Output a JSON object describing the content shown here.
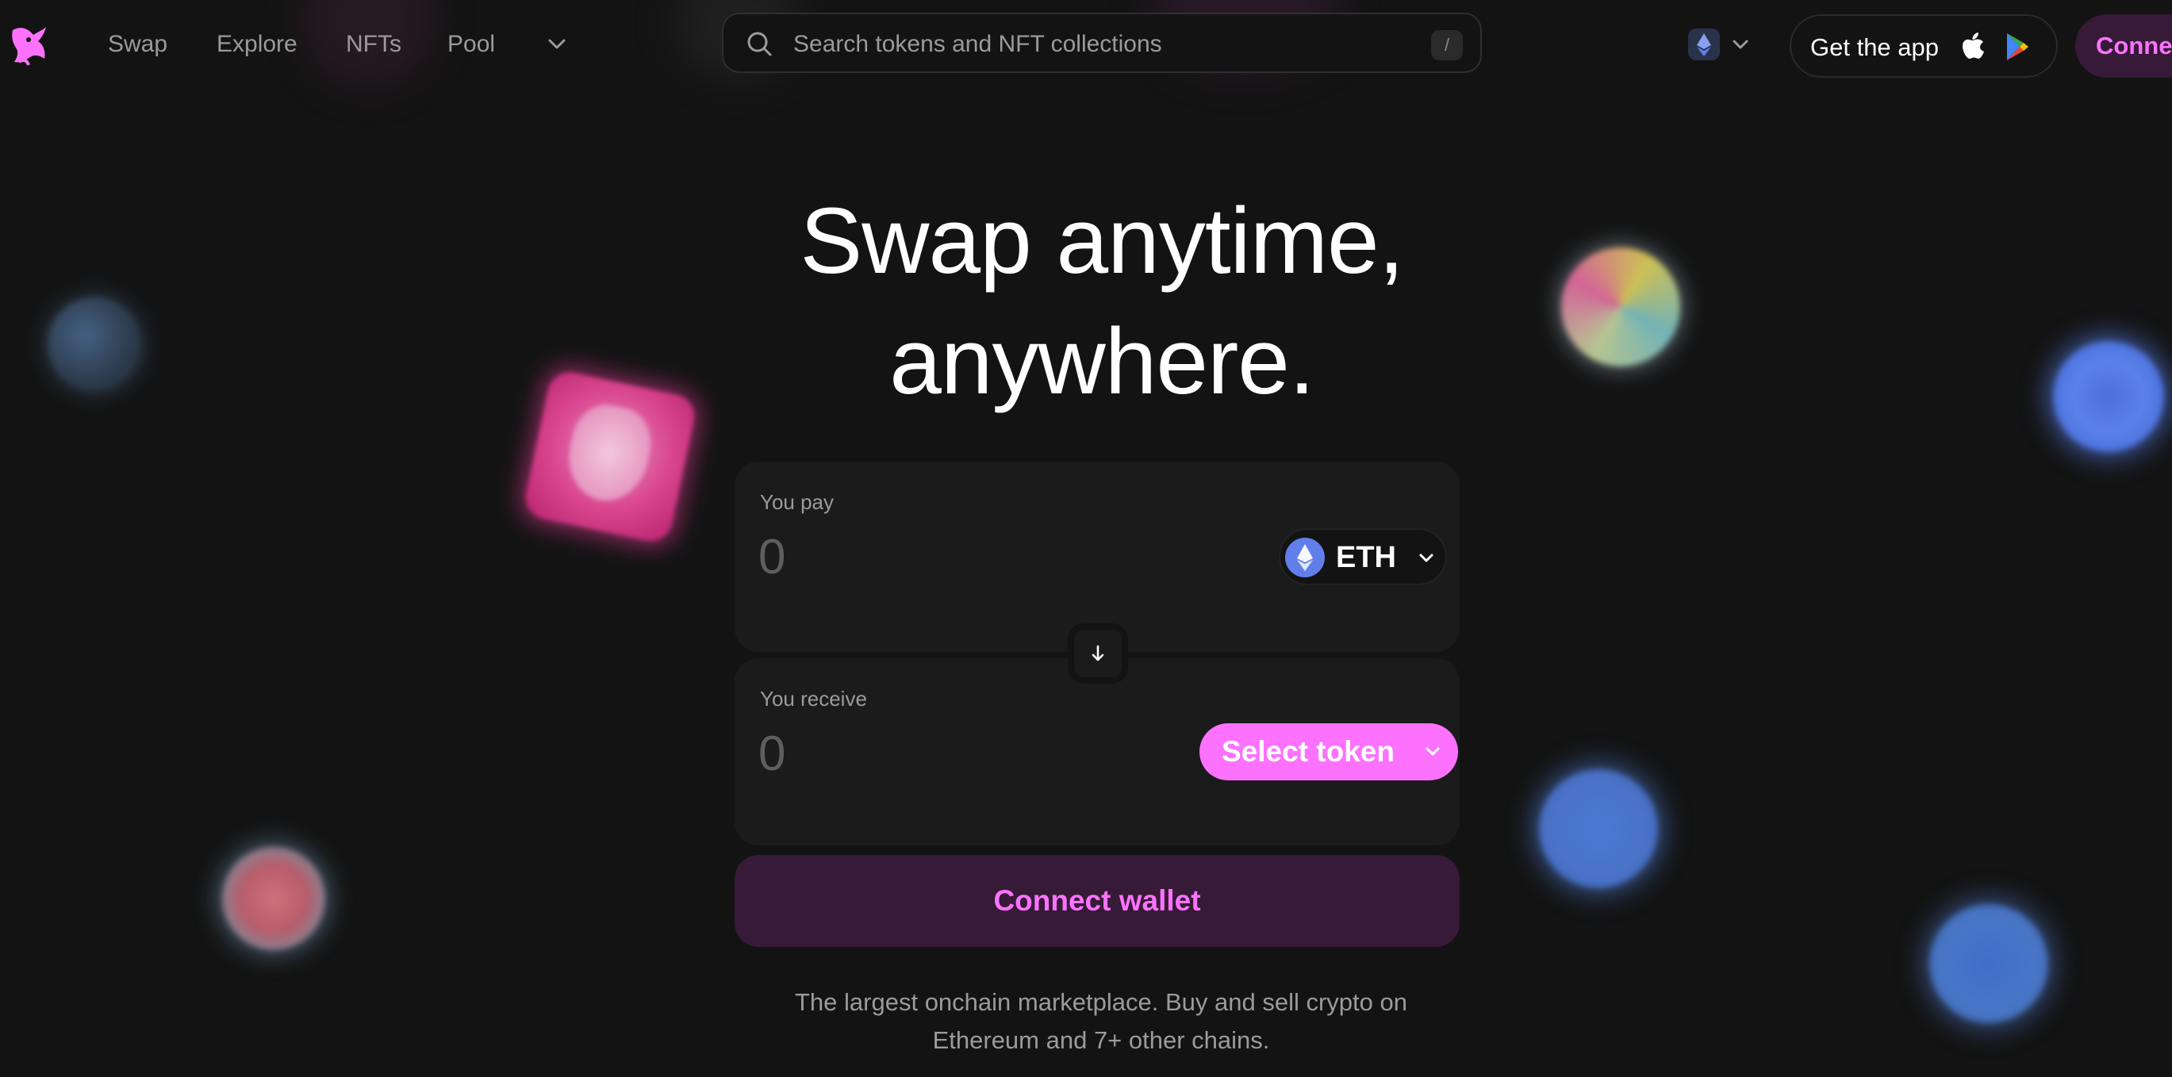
{
  "nav": {
    "links": [
      {
        "label": "Swap"
      },
      {
        "label": "Explore"
      },
      {
        "label": "NFTs"
      },
      {
        "label": "Pool"
      }
    ],
    "more_icon": "chevron-down-icon",
    "logo_icon": "unicorn-logo-icon"
  },
  "search": {
    "placeholder": "Search tokens and NFT collections",
    "shortcut": "/",
    "icon": "search-icon"
  },
  "chain_selector": {
    "icon": "ethereum-icon",
    "chevron": "chevron-down-icon"
  },
  "get_app": {
    "label": "Get the app",
    "icons": [
      "apple-icon",
      "google-play-icon"
    ]
  },
  "connect_top": {
    "label": "Conne"
  },
  "hero": {
    "title_line1": "Swap anytime,",
    "title_line2": "anywhere."
  },
  "swap": {
    "pay": {
      "label": "You pay",
      "amount_placeholder": "0",
      "token": "ETH",
      "token_icon": "ethereum-icon"
    },
    "switch_icon": "arrow-down-icon",
    "receive": {
      "label": "You receive",
      "amount_placeholder": "0",
      "select_label": "Select token"
    },
    "connect_wallet_label": "Connect wallet"
  },
  "tagline": {
    "line1": "The largest onchain marketplace. Buy and sell crypto on",
    "line2": "Ethereum and 7+ other chains."
  },
  "colors": {
    "background": "#131313",
    "panel": "#1b1b1b",
    "accent": "#fc72ff",
    "accent_soft": "#361a37",
    "muted_text": "#9b9b9b",
    "eth_blue": "#627eea"
  }
}
